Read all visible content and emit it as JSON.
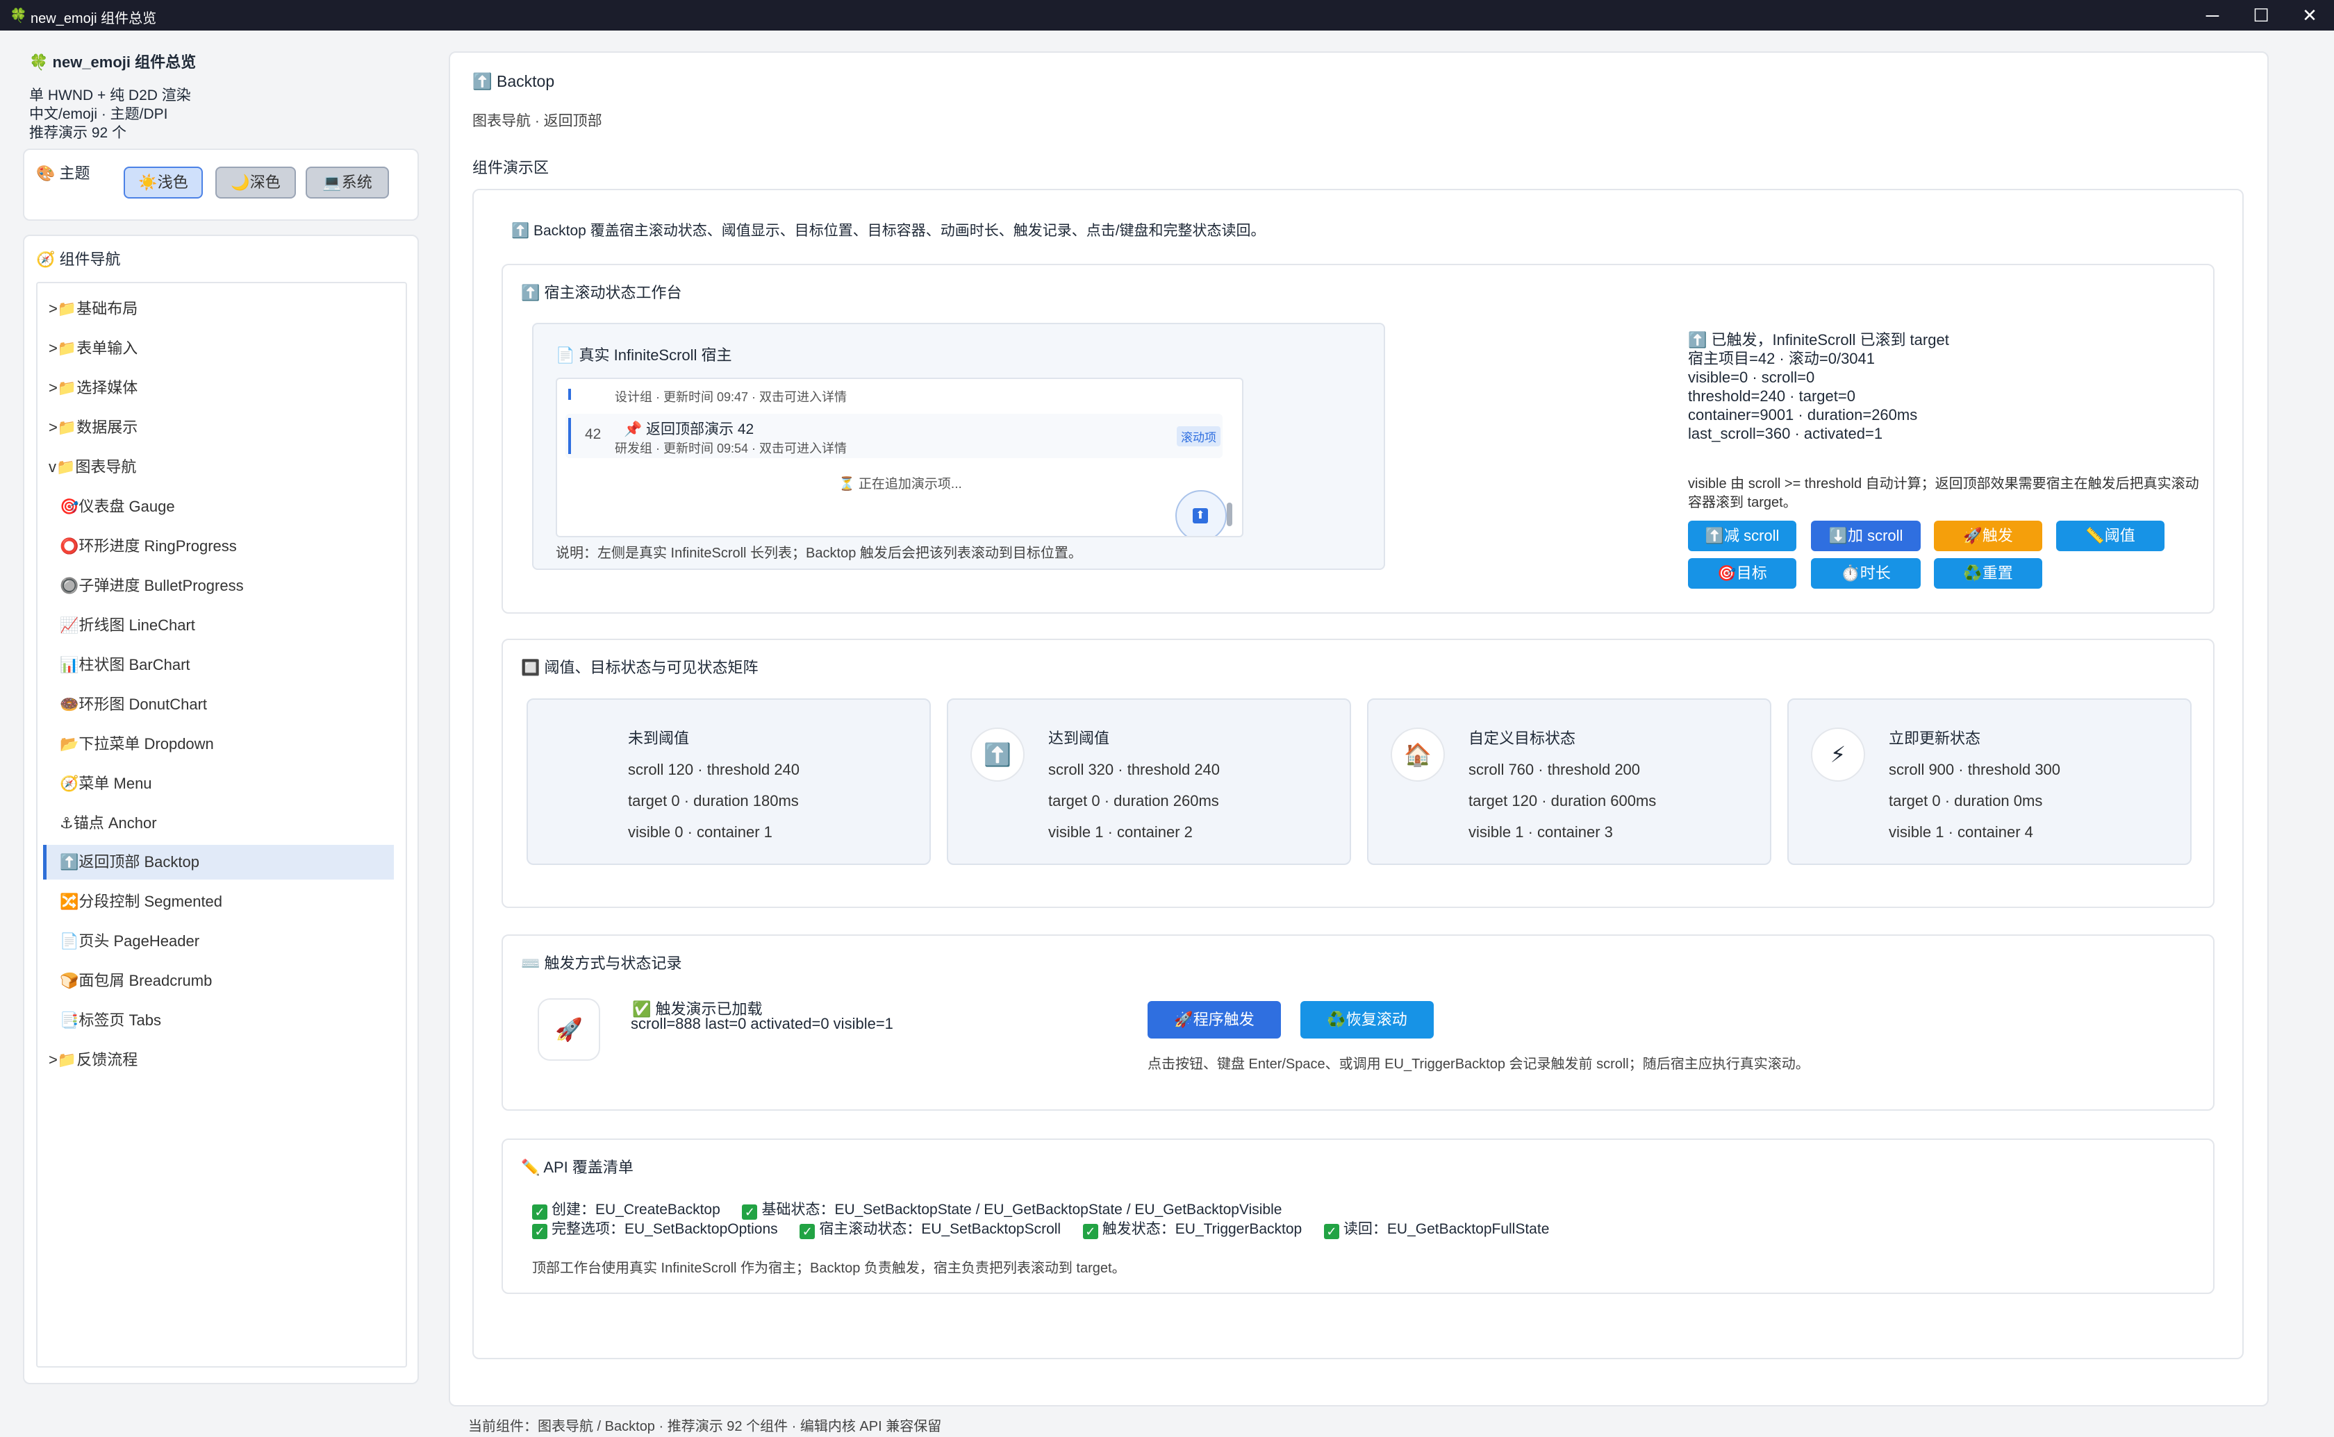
{
  "window": {
    "title": "new_emoji 组件总览",
    "app_icon": "🍀"
  },
  "sidebar": {
    "app_title": "new_emoji 组件总览",
    "info": [
      "单 HWND + 纯 D2D 渲染",
      "中文/emoji · 主题/DPI",
      "推荐演示 92 个"
    ],
    "theme_heading": "主题",
    "theme_icon": "🎨",
    "theme_buttons": [
      {
        "icon": "☀️",
        "label": "浅色"
      },
      {
        "icon": "🌙",
        "label": "深色"
      },
      {
        "icon": "💻",
        "label": "系统"
      }
    ],
    "nav_heading": "组件导航",
    "nav_icon": "🧭",
    "nav_items": [
      {
        "text": ">📁基础布局"
      },
      {
        "text": ">📁表单输入"
      },
      {
        "text": ">📁选择媒体"
      },
      {
        "text": ">📁数据展示"
      },
      {
        "text": "v📁图表导航"
      },
      {
        "text": "🎯仪表盘 Gauge"
      },
      {
        "text": "⭕环形进度 RingProgress"
      },
      {
        "text": "🔘子弹进度 BulletProgress"
      },
      {
        "text": "📈折线图 LineChart"
      },
      {
        "text": "📊柱状图 BarChart"
      },
      {
        "text": "🍩环形图 DonutChart"
      },
      {
        "text": "📂下拉菜单 Dropdown"
      },
      {
        "text": "🧭菜单 Menu"
      },
      {
        "text": "⚓锚点 Anchor"
      },
      {
        "text": "⬆️返回顶部 Backtop"
      },
      {
        "text": "🔀分段控制 Segmented"
      },
      {
        "text": "📄页头 PageHeader"
      },
      {
        "text": "🍞面包屑 Breadcrumb"
      },
      {
        "text": "📑标签页 Tabs"
      },
      {
        "text": ">📁反馈流程"
      }
    ]
  },
  "main": {
    "title": "⬆️ Backtop",
    "subtitle": "图表导航 · 返回顶部",
    "demo_section": "组件演示区",
    "intro": "⬆️ Backtop 覆盖宿主滚动状态、阈值显示、目标位置、目标容器、动画时长、触发记录、点击/键盘和完整状态读回。",
    "workbench": {
      "heading": "⬆️ 宿主滚动状态工作台",
      "host_title": "📄 真实 InfiniteScroll 宿主",
      "list_top_meta": "设计组 · 更新时间 09:47 · 双击可进入详情",
      "row_num": "42",
      "row_title": "📌 返回顶部演示 42",
      "row_meta": "研发组 · 更新时间 09:54 · 双击可进入详情",
      "row_badge": "滚动项",
      "loading": "⏳ 正在追加演示项...",
      "note": "说明：左侧是真实 InfiniteScroll 长列表；Backtop 触发后会把该列表滚动到目标位置。",
      "status_lines": [
        "⬆️ 已触发，InfiniteScroll 已滚到 target",
        "宿主项目=42 · 滚动=0/3041",
        "visible=0 · scroll=0",
        "threshold=240 · target=0",
        "container=9001 · duration=260ms",
        "last_scroll=360 · activated=1"
      ],
      "status_note": "visible 由 scroll >= threshold 自动计算；返回顶部效果需要宿主在触发后把真实滚动容器滚到 target。",
      "buttons": [
        {
          "label": "⬆️减 scroll",
          "color": "#1793e6"
        },
        {
          "label": "⬇️加 scroll",
          "color": "#2f6fe0"
        },
        {
          "label": "🚀触发",
          "color": "#f59f0b"
        },
        {
          "label": "📏阈值",
          "color": "#1793e6"
        },
        {
          "label": "🎯目标",
          "color": "#1793e6"
        },
        {
          "label": "⏱️时长",
          "color": "#1793e6"
        },
        {
          "label": "♻️重置",
          "color": "#1793e6"
        }
      ]
    },
    "matrix": {
      "heading": "阈值、目标状态与可见状态矩阵",
      "icon": "🔲",
      "cards": [
        {
          "icon": "",
          "title": "未到阈值",
          "lines": [
            "scroll 120 · threshold 240",
            "target 0 · duration 180ms",
            "visible 0 · container 1"
          ]
        },
        {
          "icon": "⬆️",
          "title": "达到阈值",
          "lines": [
            "scroll 320 · threshold 240",
            "target 0 · duration 260ms",
            "visible 1 · container 2"
          ]
        },
        {
          "icon": "🏠",
          "title": "自定义目标状态",
          "lines": [
            "scroll 760 · threshold 200",
            "target 120 · duration 600ms",
            "visible 1 · container 3"
          ]
        },
        {
          "icon": "⚡",
          "title": "立即更新状态",
          "lines": [
            "scroll 900 · threshold 300",
            "target 0 · duration 0ms",
            "visible 1 · container 4"
          ]
        }
      ]
    },
    "trigger": {
      "heading": "触发方式与状态记录",
      "icon": "⌨️",
      "rocket": "🚀",
      "loaded": "✅ 触发演示已加载",
      "state": "scroll=888 last=0 activated=0 visible=1",
      "btn_program": "🚀程序触发",
      "btn_restore": "♻️恢复滚动",
      "note": "点击按钮、键盘 Enter/Space、或调用 EU_TriggerBacktop 会记录触发前 scroll；随后宿主应执行真实滚动。"
    },
    "api": {
      "heading": "API 覆盖清单",
      "icon": "✏️",
      "line1": [
        "创建：EU_CreateBacktop",
        "基础状态：EU_SetBacktopState / EU_GetBacktopState / EU_GetBacktopVisible"
      ],
      "line2": [
        "完整选项：EU_SetBacktopOptions",
        "宿主滚动状态：EU_SetBacktopScroll",
        "触发状态：EU_TriggerBacktop",
        "读回：EU_GetBacktopFullState"
      ],
      "note": "顶部工作台使用真实 InfiniteScroll 作为宿主；Backtop 负责触发，宿主负责把列表滚动到 target。"
    }
  },
  "footer": "当前组件：图表导航 / Backtop · 推荐演示 92 个组件 · 编辑内核 API 兼容保留"
}
